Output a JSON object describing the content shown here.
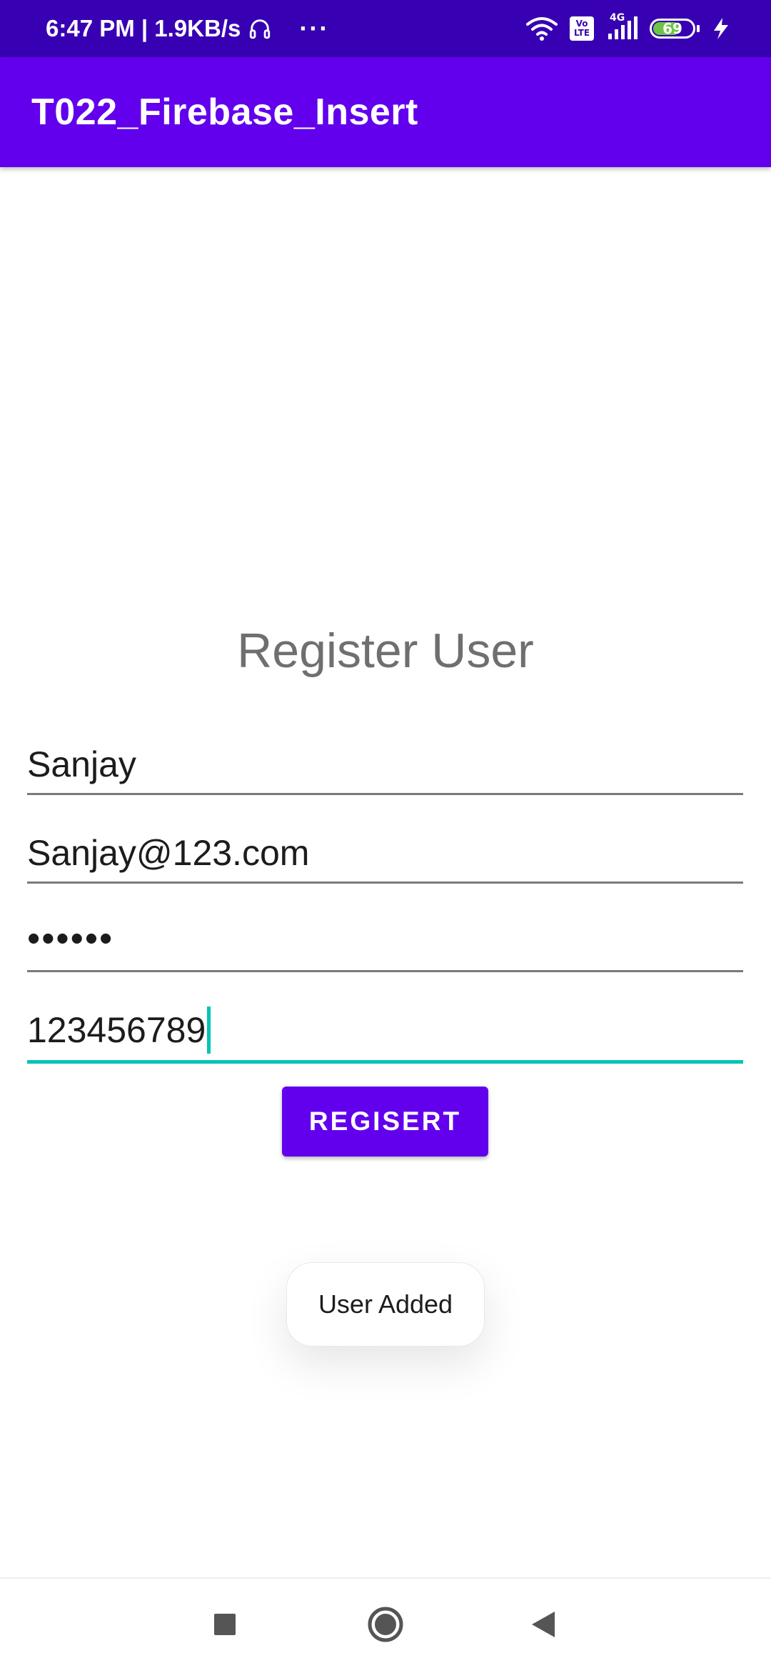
{
  "status_bar": {
    "time_and_speed": "6:47 PM | 1.9KB/s",
    "overflow": "···",
    "volte_top": "Vo",
    "volte_bottom": "LTE",
    "network_type": "4G",
    "battery_level": 69,
    "battery_label": "69"
  },
  "app_bar": {
    "title": "T022_Firebase_Insert"
  },
  "form": {
    "title": "Register User",
    "name_value": "Sanjay",
    "email_value": "Sanjay@123.com",
    "password_value": "••••••",
    "phone_value": "123456789",
    "register_label": "REGISERT"
  },
  "toast": {
    "message": "User Added"
  },
  "colors": {
    "status_bar": "#3700b3",
    "app_bar": "#6200ee",
    "accent": "#03c4b4",
    "battery": "#6cc644"
  },
  "nav": {
    "icons": [
      "recents-icon",
      "home-icon",
      "back-icon"
    ]
  }
}
